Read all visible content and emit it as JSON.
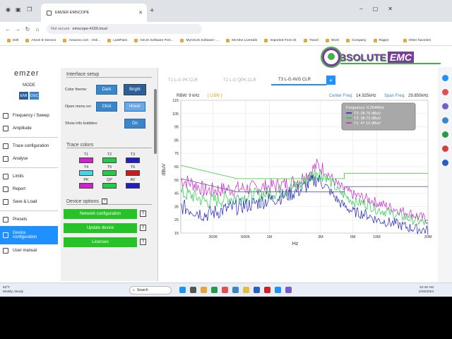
{
  "browser": {
    "tab_title": "EMZER EMSCOPE",
    "not_secure": "Not secure",
    "url": "emscope-4159.local",
    "bookmarks": [
      "Dell",
      "ASUS E-Service",
      "Amazon.com - Onli...",
      "LastPass",
      "ASUS Software Port...",
      "MyASUS Software -...",
      "McAfee LiveSafe",
      "Imported From IE",
      "Travel",
      "Work",
      "Company",
      "Rapps"
    ],
    "other_favorites": "Other favorites"
  },
  "logo": {
    "main": "BSOLUTE",
    "suffix": "EMC"
  },
  "app": {
    "brand": "emzer",
    "mode_label": "MODE",
    "mode_options": [
      "EMI",
      "OSC"
    ],
    "nav": [
      "Frequency / Sweep",
      "Amplitude",
      "Trace configuration",
      "Analyse",
      "Limits",
      "Report",
      "Save & Load",
      "Presets",
      "Device configuration",
      "User manual"
    ]
  },
  "panel": {
    "interface_title": "Interface setup",
    "color_theme_label": "Color theme:",
    "color_theme_options": [
      "Dark",
      "Bright"
    ],
    "open_menu_label": "Open menu on:",
    "open_menu_options": [
      "Click",
      "Hover"
    ],
    "info_bubbles_label": "Show info bubbles:",
    "info_bubbles_value": "On",
    "trace_colors_title": "Trace colors",
    "traces": [
      {
        "name": "T1",
        "color": "#d020d0"
      },
      {
        "name": "T2",
        "color": "#22cc44"
      },
      {
        "name": "T3",
        "color": "#2020c0"
      },
      {
        "name": "T4",
        "color": "#40d8e8"
      },
      {
        "name": "T5",
        "color": "#22cc44"
      },
      {
        "name": "T6",
        "color": "#d01818"
      },
      {
        "name": "PK",
        "color": "#d020d0"
      },
      {
        "name": "QP",
        "color": "#22cc44"
      },
      {
        "name": "AV",
        "color": "#2020c0"
      }
    ],
    "device_options_title": "Device options",
    "buttons": [
      "Network configuration",
      "Update device",
      "Licenses"
    ]
  },
  "trace_tabs": [
    "T1 L-G PK CLR",
    "T2 L-G QPK CLR",
    "T3 L-G AVG CLR"
  ],
  "chart_header": {
    "rbw": "RBW: 9 kHz",
    "lisn": "[ LISN ]",
    "center_label": "Center Freq:",
    "center_value": "14.925kHz",
    "span_label": "Span Freq:",
    "span_value": "29.850kHz"
  },
  "chart_data": {
    "type": "line",
    "xlabel": "Hz",
    "ylabel": "dBuV",
    "xscale": "log",
    "xlim": [
      150000,
      30000000
    ],
    "ylim": [
      15,
      115
    ],
    "yticks": [
      15,
      25,
      35,
      45,
      55,
      65,
      75,
      85,
      95,
      105,
      115
    ],
    "xticks": [
      {
        "v": 300000,
        "l": "300K"
      },
      {
        "v": 600000,
        "l": "600K"
      },
      {
        "v": 1000000,
        "l": "1M"
      },
      {
        "v": 3000000,
        "l": "3M"
      },
      {
        "v": 6000000,
        "l": "6M"
      },
      {
        "v": 10000000,
        "l": "10M"
      },
      {
        "v": 30000000,
        "l": "30M"
      }
    ],
    "tooltip": {
      "frequency": "Frequency: 0.254MHz",
      "entries": [
        {
          "text": "T3: 28.79 dBuV",
          "color": "#2020c0"
        },
        {
          "text": "T2: 38.73 dBuV",
          "color": "#22cc44"
        },
        {
          "text": "T1: 47.12 dBuV",
          "color": "#d020d0"
        }
      ]
    },
    "series": [
      {
        "name": "T1",
        "color": "#d020d0",
        "points": [
          [
            150000,
            55
          ],
          [
            200000,
            52
          ],
          [
            254000,
            47
          ],
          [
            400000,
            48
          ],
          [
            700000,
            49
          ],
          [
            1000000,
            50
          ],
          [
            1500000,
            52
          ],
          [
            2000000,
            56
          ],
          [
            2800000,
            66
          ],
          [
            3300000,
            62
          ],
          [
            4500000,
            50
          ],
          [
            6000000,
            44
          ],
          [
            8000000,
            41
          ],
          [
            10000000,
            38
          ],
          [
            15000000,
            33
          ],
          [
            20000000,
            30
          ],
          [
            30000000,
            25
          ]
        ]
      },
      {
        "name": "T2",
        "color": "#22cc44",
        "points": [
          [
            150000,
            45
          ],
          [
            200000,
            43
          ],
          [
            254000,
            38.7
          ],
          [
            400000,
            41
          ],
          [
            700000,
            43
          ],
          [
            1000000,
            45
          ],
          [
            1500000,
            48
          ],
          [
            2000000,
            52
          ],
          [
            2800000,
            62
          ],
          [
            3300000,
            58
          ],
          [
            4500000,
            46
          ],
          [
            6000000,
            39
          ],
          [
            8000000,
            37
          ],
          [
            10000000,
            33
          ],
          [
            15000000,
            29
          ],
          [
            20000000,
            26
          ],
          [
            30000000,
            22
          ]
        ]
      },
      {
        "name": "T3",
        "color": "#2020c0",
        "points": [
          [
            150000,
            35
          ],
          [
            200000,
            32
          ],
          [
            254000,
            28.8
          ],
          [
            400000,
            33
          ],
          [
            700000,
            37
          ],
          [
            1000000,
            40
          ],
          [
            1500000,
            44
          ],
          [
            2000000,
            48
          ],
          [
            2800000,
            56
          ],
          [
            3300000,
            51
          ],
          [
            4500000,
            38
          ],
          [
            6000000,
            31
          ],
          [
            8000000,
            29
          ],
          [
            10000000,
            25
          ],
          [
            15000000,
            22
          ],
          [
            20000000,
            19
          ],
          [
            30000000,
            17
          ]
        ]
      },
      {
        "name": "QP limit",
        "color": "#33cc33",
        "points": [
          [
            150000,
            66
          ],
          [
            500000,
            56
          ],
          [
            5000000,
            56
          ],
          [
            5000000,
            60
          ],
          [
            30000000,
            60
          ]
        ]
      },
      {
        "name": "AV limit",
        "color": "#6060a0",
        "points": [
          [
            150000,
            56
          ],
          [
            500000,
            46
          ],
          [
            5000000,
            46
          ],
          [
            5000000,
            50
          ],
          [
            30000000,
            50
          ]
        ]
      }
    ]
  },
  "taskbar": {
    "temp": "63°F",
    "weather": "Mostly cloudy",
    "search": "Search",
    "time": "10:40 AM",
    "date": "4/26/2024"
  }
}
